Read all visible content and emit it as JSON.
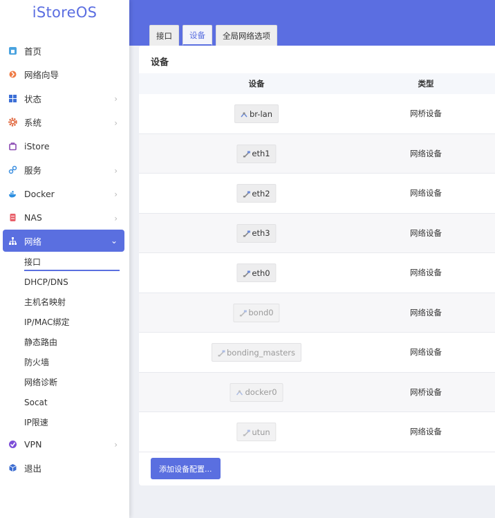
{
  "brand": "iStoreOS",
  "menu": [
    {
      "label": "首页",
      "icon": "home-icon",
      "chev": false
    },
    {
      "label": "网络向导",
      "icon": "wizard-icon",
      "chev": false
    },
    {
      "label": "状态",
      "icon": "status-icon",
      "chev": true
    },
    {
      "label": "系统",
      "icon": "system-gear-icon",
      "chev": true
    },
    {
      "label": "iStore",
      "icon": "store-icon",
      "chev": false
    },
    {
      "label": "服务",
      "icon": "services-icon",
      "chev": true
    },
    {
      "label": "Docker",
      "icon": "docker-icon",
      "chev": true
    },
    {
      "label": "NAS",
      "icon": "nas-icon",
      "chev": true
    },
    {
      "label": "网络",
      "icon": "network-icon",
      "chev": true,
      "active": true
    }
  ],
  "submenu": [
    "接口",
    "DHCP/DNS",
    "主机名映射",
    "IP/MAC绑定",
    "静态路由",
    "防火墙",
    "网络诊断",
    "Socat",
    "IP限速"
  ],
  "menu_after": [
    {
      "label": "VPN",
      "icon": "vpn-icon",
      "chev": true
    },
    {
      "label": "退出",
      "icon": "logout-icon",
      "chev": false
    }
  ],
  "tabs": [
    "接口",
    "设备",
    "全局网络选项"
  ],
  "active_tab": 1,
  "section_title": "设备",
  "columns": {
    "device": "设备",
    "type": "类型"
  },
  "rows": [
    {
      "device": "br-lan",
      "type": "网桥设备",
      "dim": false,
      "icon": "bridge-icon"
    },
    {
      "device": "eth1",
      "type": "网络设备",
      "dim": false,
      "icon": "ethernet-icon"
    },
    {
      "device": "eth2",
      "type": "网络设备",
      "dim": false,
      "icon": "ethernet-icon"
    },
    {
      "device": "eth3",
      "type": "网络设备",
      "dim": false,
      "icon": "ethernet-icon"
    },
    {
      "device": "eth0",
      "type": "网络设备",
      "dim": false,
      "icon": "ethernet-icon"
    },
    {
      "device": "bond0",
      "type": "网络设备",
      "dim": true,
      "icon": "ethernet-icon"
    },
    {
      "device": "bonding_masters",
      "type": "网络设备",
      "dim": true,
      "icon": "ethernet-icon"
    },
    {
      "device": "docker0",
      "type": "网桥设备",
      "dim": true,
      "icon": "bridge-icon"
    },
    {
      "device": "utun",
      "type": "网络设备",
      "dim": true,
      "icon": "ethernet-icon"
    }
  ],
  "add_button": "添加设备配置...",
  "colors": {
    "accent": "#5a6fe0",
    "header": "#5b6ee1"
  }
}
